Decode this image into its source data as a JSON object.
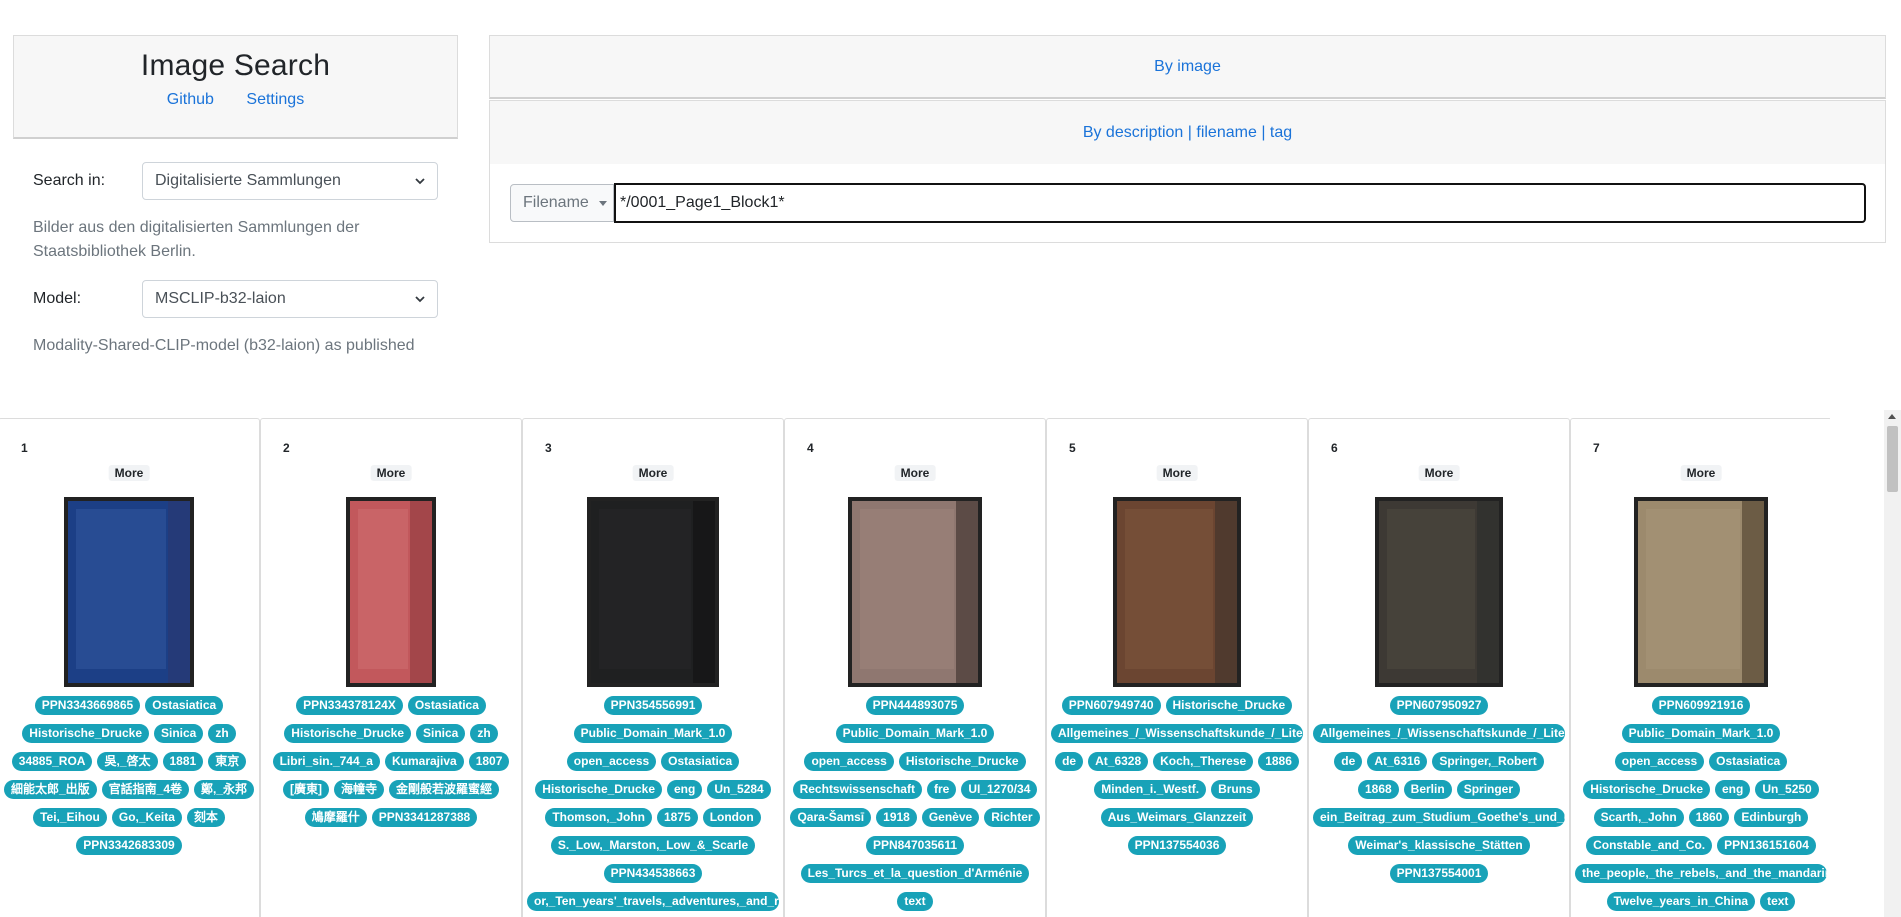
{
  "app": {
    "title": "Image Search",
    "links": [
      "Github",
      "Settings"
    ]
  },
  "settings": {
    "search_in_label": "Search in:",
    "search_in_value": "Digitalisierte Sammlungen",
    "search_in_help": "Bilder aus den digitalisierten Sammlungen der Staatsbibliothek Berlin.",
    "model_label": "Model:",
    "model_value": "MSCLIP-b32-laion",
    "model_help": "Modality-Shared-CLIP-model (b32-laion) as published"
  },
  "search": {
    "tab_image": "By image",
    "tab_description": "By description",
    "tab_filename": "filename",
    "tab_tag": "tag",
    "separator": "|",
    "mode_label": "Filename",
    "query": "*/0001_Page1_Block1*"
  },
  "colors": {
    "link": "#1a73d9",
    "tag": "#18a2b8",
    "panel": "#f7f7f7"
  },
  "results": [
    {
      "index": "1",
      "more": "More",
      "cover": "#1c3f86",
      "cover_accent": "#3e63ad",
      "spine": "#2b3770",
      "tags": [
        "PPN3343669865",
        "Ostasiatica",
        "Historische_Drucke",
        "Sinica",
        "zh",
        "34885_ROA",
        "吳,_啓太",
        "1881",
        "東京",
        "細能太郎_出版",
        "官話指南_4卷",
        "鄭,_永邦",
        "Tei,_Eihou",
        "Go,_Keita",
        "刻本",
        "PPN3342683309"
      ]
    },
    {
      "index": "2",
      "more": "More",
      "cover": "#c2585c",
      "cover_accent": "#d77a7c",
      "spine": "#8e3a3e",
      "tags": [
        "PPN334378124X",
        "Ostasiatica",
        "Historische_Drucke",
        "Sinica",
        "zh",
        "Libri_sin._744_a",
        "Kumarajiva",
        "1807",
        "[廣東]",
        "海幢寺",
        "金剛般若波羅蜜經",
        "鳩摩羅什",
        "PPN3341287388"
      ]
    },
    {
      "index": "3",
      "more": "More",
      "cover": "#1f2021",
      "cover_accent": "#2b2c2d",
      "spine": "#121212",
      "tags": [
        "PPN354556991",
        "Public_Domain_Mark_1.0",
        "open_access",
        "Ostasiatica",
        "Historische_Drucke",
        "eng",
        "Un_5284",
        "Thomson,_John",
        "1875",
        "London",
        "S._Low,_Marston,_Low_&_Scarle",
        "PPN434538663",
        "or,_Ten_years'_travels,_adventures,_and_res"
      ]
    },
    {
      "index": "4",
      "more": "More",
      "cover": "#8f7770",
      "cover_accent": "#a58c82",
      "spine": "#3a2e2a",
      "tags": [
        "PPN444893075",
        "Public_Domain_Mark_1.0",
        "open_access",
        "Historische_Drucke",
        "Rechtswissenschaft",
        "fre",
        "UI_1270/34",
        "Qara-Šamsī",
        "1918",
        "Genève",
        "Richter",
        "PPN847035611",
        "Les_Turcs_et_la_question_d'Arménie",
        "text"
      ]
    },
    {
      "index": "5",
      "more": "More",
      "cover": "#6b4531",
      "cover_accent": "#8a5f45",
      "spine": "#3e332d",
      "tags": [
        "PPN607949740",
        "Historische_Drucke",
        "Allgemeines_/_Wissenschaftskunde_/_Literatur",
        "de",
        "At_6328",
        "Koch,_Therese",
        "1886",
        "Minden_i._Westf.",
        "Bruns",
        "Aus_Weimars_Glanzzeit",
        "PPN137554036"
      ]
    },
    {
      "index": "6",
      "more": "More",
      "cover": "#3d3934",
      "cover_accent": "#5a5247",
      "spine": "#2b2e2d",
      "tags": [
        "PPN607950927",
        "Allgemeines_/_Wissenschaftskunde_/_Literatur",
        "de",
        "At_6316",
        "Springer,_Robert",
        "1868",
        "Berlin",
        "Springer",
        "ein_Beitrag_zum_Studium_Goethe's_und_und",
        "Weimar's_klassische_Stätten",
        "PPN137554001"
      ]
    },
    {
      "index": "7",
      "more": "More",
      "cover": "#9c8a6d",
      "cover_accent": "#ae9c7e",
      "spine": "#4d3d2b",
      "tags": [
        "PPN609921916",
        "Public_Domain_Mark_1.0",
        "open_access",
        "Ostasiatica",
        "Historische_Drucke",
        "eng",
        "Un_5250",
        "Scarth,_John",
        "1860",
        "Edinburgh",
        "Constable_and_Co.",
        "PPN136151604",
        "the_people,_the_rebels,_and_the_mandarins",
        "Twelve_years_in_China",
        "text"
      ]
    }
  ]
}
